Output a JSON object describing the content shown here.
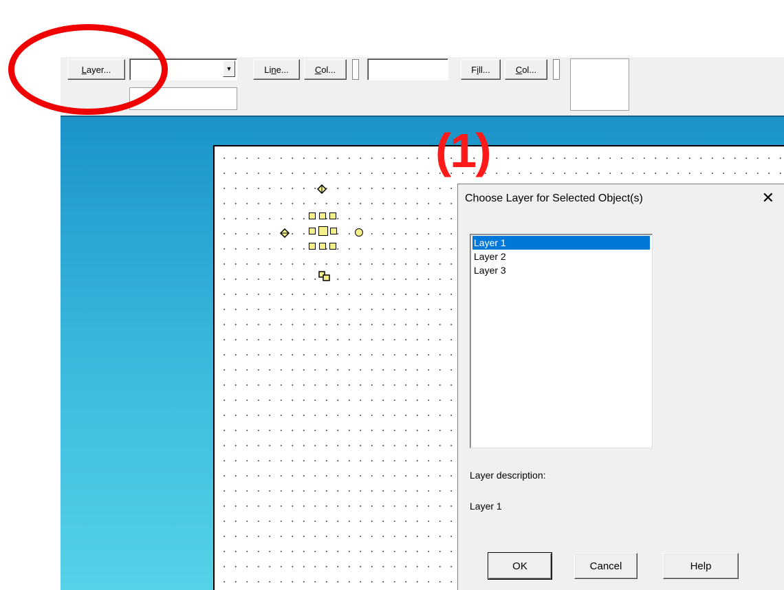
{
  "toolbar": {
    "layer_button": {
      "label_u": "L",
      "label_rest": "ayer..."
    },
    "layer_dropdown_value": "",
    "line_button": {
      "label_pre": "Li",
      "label_u": "n",
      "label_rest": "e..."
    },
    "line_color_button": {
      "label_u": "C",
      "label_rest": "ol..."
    },
    "line_style_value": "",
    "fill_button": {
      "label_pre": "F",
      "label_u": "i",
      "label_rest": "ll..."
    },
    "fill_color_button": {
      "label_u": "C",
      "label_rest": "ol..."
    },
    "bottom_field_value": ""
  },
  "dialog": {
    "title": "Choose Layer for Selected Object(s)",
    "close_glyph": "✕",
    "layers": [
      "Layer 1",
      "Layer 2",
      "Layer 3"
    ],
    "selected_layer": "Layer 1",
    "description_label": "Layer description:",
    "description_value": "Layer 1",
    "ok_label": "OK",
    "cancel_label": "Cancel",
    "help_label": "Help"
  },
  "annotation": {
    "step_number": "(1)",
    "highlight_color": "#f00000"
  },
  "colors": {
    "selection": "#0078d7",
    "handle_fill": "#f6f08a",
    "workspace_top": "#1b93c8",
    "workspace_bottom": "#55d2e8"
  },
  "icons": [
    "dropdown-arrow-icon",
    "close-icon",
    "rotate-handle-icon",
    "connector-handle-icon"
  ]
}
